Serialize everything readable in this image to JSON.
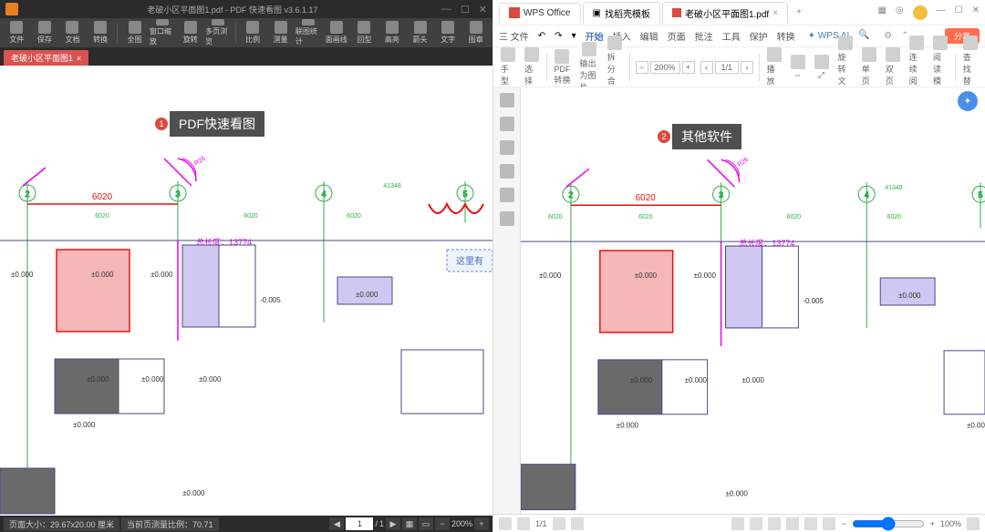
{
  "left": {
    "title": "老破小区平面图1.pdf - PDF 快速看图 v3.6.1.17",
    "toolbar": [
      "文件",
      "保存",
      "文档",
      "转换",
      "全图",
      "窗口缩放",
      "旋转",
      "多页浏览",
      "比例",
      "测量",
      "联图统计",
      "面画线",
      "回型",
      "高亮",
      "箭头",
      "文字",
      "图章"
    ],
    "tab": "老破小区平面图1",
    "status_size": "页面大小：29.67x20.00 厘米",
    "status_scale": "当前页测量比例：70.71",
    "page": "1",
    "total": "1",
    "zoom": "200%",
    "badge_num": "1",
    "badge_text": "PDF快速看图"
  },
  "right": {
    "tabs": {
      "wps": "WPS Office",
      "clip": "找稻壳模板",
      "doc": "老破小区平面图1.pdf"
    },
    "file_menu": "三 文件",
    "menus": [
      "开始",
      "插入",
      "编辑",
      "页面",
      "批注",
      "工具",
      "保护",
      "转换"
    ],
    "ai": "WPS AI",
    "share": "分享",
    "tool_row1": {
      "hand": "手型",
      "select": "选择",
      "convert": "PDF转换",
      "export_img": "输出为图片",
      "split": "拆分合并",
      "play": "播放",
      "rotate": "旋转文档",
      "single": "单页",
      "double": "双页",
      "continuous": "连续阅读",
      "read_mode": "阅读模式",
      "find_replace": "查找替换"
    },
    "zoom": "200%",
    "page": "1/1",
    "badge_num": "2",
    "badge_text": "其他软件",
    "status_page": "1/1",
    "status_zoom": "100%"
  },
  "drawing": {
    "grid_marks": [
      "2",
      "3",
      "4",
      "5"
    ],
    "dim_6020": "6020",
    "dims_small": "6020",
    "dim_413x8": "41348",
    "total_len_label": "总长度：",
    "total_len_val": "13774",
    "elev_0": "±0.000",
    "elev_neg": "-0.005",
    "note_here": "这里有",
    "r26_label": "R26"
  }
}
